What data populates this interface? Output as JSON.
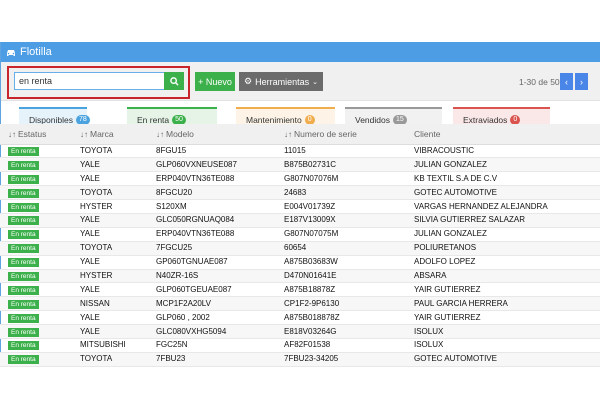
{
  "window": {
    "title": "Flotilla"
  },
  "search": {
    "value": "en renta"
  },
  "buttons": {
    "new_label": "+ Nuevo",
    "tools_label": "Herramientas"
  },
  "pager": {
    "range": "1-30 de 50",
    "prev": "‹",
    "next": "›"
  },
  "tabs": [
    {
      "label": "Disponibles",
      "count": "78",
      "color": "#4aa3df"
    },
    {
      "label": "En renta",
      "count": "50",
      "color": "#3cb04a"
    },
    {
      "label": "Mantenimiento",
      "count": "0",
      "color": "#f0ad4e"
    },
    {
      "label": "Vendidos",
      "count": "15",
      "color": "#999999"
    },
    {
      "label": "Extraviados",
      "count": "0",
      "color": "#d9534f"
    }
  ],
  "table": {
    "headers": [
      "Estatus",
      "Marca",
      "Modelo",
      "Numero de serie",
      "Cliente"
    ],
    "rows": [
      [
        "En renta",
        "TOYOTA",
        "8FGU15",
        "11015",
        "VIBRACOUSTIC"
      ],
      [
        "En renta",
        "YALE",
        "GLP060VXNEUSE087",
        "B875B02731C",
        "JULIAN GONZALEZ"
      ],
      [
        "En renta",
        "YALE",
        "ERP040VTN36TE088",
        "G807N07076M",
        "KB TEXTIL S.A DE C.V"
      ],
      [
        "En renta",
        "TOYOTA",
        "8FGCU20",
        "24683",
        "GOTEC AUTOMOTIVE"
      ],
      [
        "En renta",
        "HYSTER",
        "S120XM",
        "E004V01739Z",
        "VARGAS HERNANDEZ ALEJANDRA"
      ],
      [
        "En renta",
        "YALE",
        "GLC050RGNUAQ084",
        "E187V13009X",
        "SILVIA GUTIERREZ SALAZAR"
      ],
      [
        "En renta",
        "YALE",
        "ERP040VTN36TE088",
        "G807N07075M",
        "JULIAN GONZALEZ"
      ],
      [
        "En renta",
        "TOYOTA",
        "7FGCU25",
        "60654",
        "POLIURETANOS"
      ],
      [
        "En renta",
        "YALE",
        "GP060TGNUAE087",
        "A875B03683W",
        "ADOLFO LOPEZ"
      ],
      [
        "En renta",
        "HYSTER",
        "N40ZR-16S",
        "D470N01641E",
        "ABSARA"
      ],
      [
        "En renta",
        "YALE",
        "GLP060TGEUAE087",
        "A875B18878Z",
        "YAIR GUTIERREZ"
      ],
      [
        "En renta",
        "NISSAN",
        "MCP1F2A20LV",
        "CP1F2-9P6130",
        "PAUL GARCIA HERRERA"
      ],
      [
        "En renta",
        "YALE",
        "GLP060 , 2002",
        "A875B018878Z",
        "YAIR GUTIERREZ"
      ],
      [
        "En renta",
        "YALE",
        "GLC080VXHG5094",
        "E818V03264G",
        "ISOLUX"
      ],
      [
        "En renta",
        "MITSUBISHI",
        "FGC25N",
        "AF82F01538",
        "ISOLUX"
      ],
      [
        "En renta",
        "TOYOTA",
        "7FBU23",
        "7FBU23-34205",
        "GOTEC AUTOMOTIVE"
      ]
    ]
  },
  "colors": {
    "accent": "#4d9de5",
    "success": "#3cb04a",
    "highlight": "#c8242b"
  }
}
